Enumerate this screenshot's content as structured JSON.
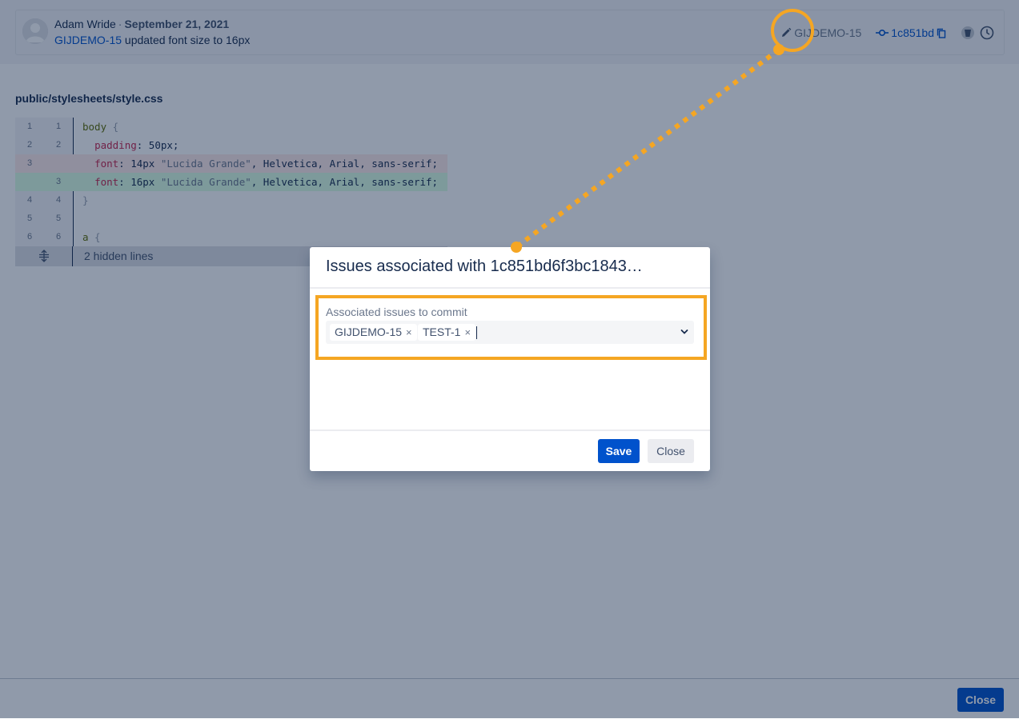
{
  "commit": {
    "author": "Adam Wride",
    "separator": "·",
    "date": "September 21, 2021",
    "issue_key": "GIJDEMO-15",
    "message": "updated font size to 16px",
    "linked_issue": "GIJDEMO-15",
    "short_hash": "1c851bd"
  },
  "file": {
    "path": "public/stylesheets/style.css",
    "rows": [
      {
        "old": "1",
        "new": "1",
        "type": "ctx"
      },
      {
        "old": "2",
        "new": "2",
        "type": "ctx"
      },
      {
        "old": "3",
        "new": "",
        "type": "del"
      },
      {
        "old": "",
        "new": "3",
        "type": "add"
      },
      {
        "old": "4",
        "new": "4",
        "type": "ctx"
      },
      {
        "old": "5",
        "new": "5",
        "type": "ctx"
      },
      {
        "old": "6",
        "new": "6",
        "type": "ctx"
      }
    ],
    "code": {
      "l1_sel": "body",
      "l1_brace": " {",
      "l2_prop": "padding",
      "l2_val": ": 50px;",
      "l3_prop": "font",
      "l3_size": ": 14px ",
      "l3_str": "\"Lucida Grande\"",
      "l3_rest": ", Helvetica, Arial, sans-serif;",
      "l4_prop": "font",
      "l4_size": ": 16px ",
      "l4_str": "\"Lucida Grande\"",
      "l4_rest": ", Helvetica, Arial, sans-serif;",
      "l5": "}",
      "l7_sel": "a",
      "l7_brace": " {"
    },
    "hidden_lines": "2 hidden lines"
  },
  "modal": {
    "title": "Issues associated with 1c851bd6f3bc1843…",
    "field_label": "Associated issues to commit",
    "tags": [
      "GIJDEMO-15",
      "TEST-1"
    ],
    "remove_glyph": "×",
    "save_label": "Save",
    "close_label": "Close"
  },
  "footer": {
    "close_label": "Close"
  },
  "colors": {
    "primary": "#0052cc",
    "annotation": "#f5a623",
    "overlay": "rgba(9,30,66,0.45)"
  },
  "icons": [
    "avatar-icon",
    "pencil-icon",
    "commit-icon",
    "copy-icon",
    "bitbucket-icon",
    "history-icon",
    "expand-icon",
    "chevron-down-icon",
    "remove-tag-icon"
  ]
}
